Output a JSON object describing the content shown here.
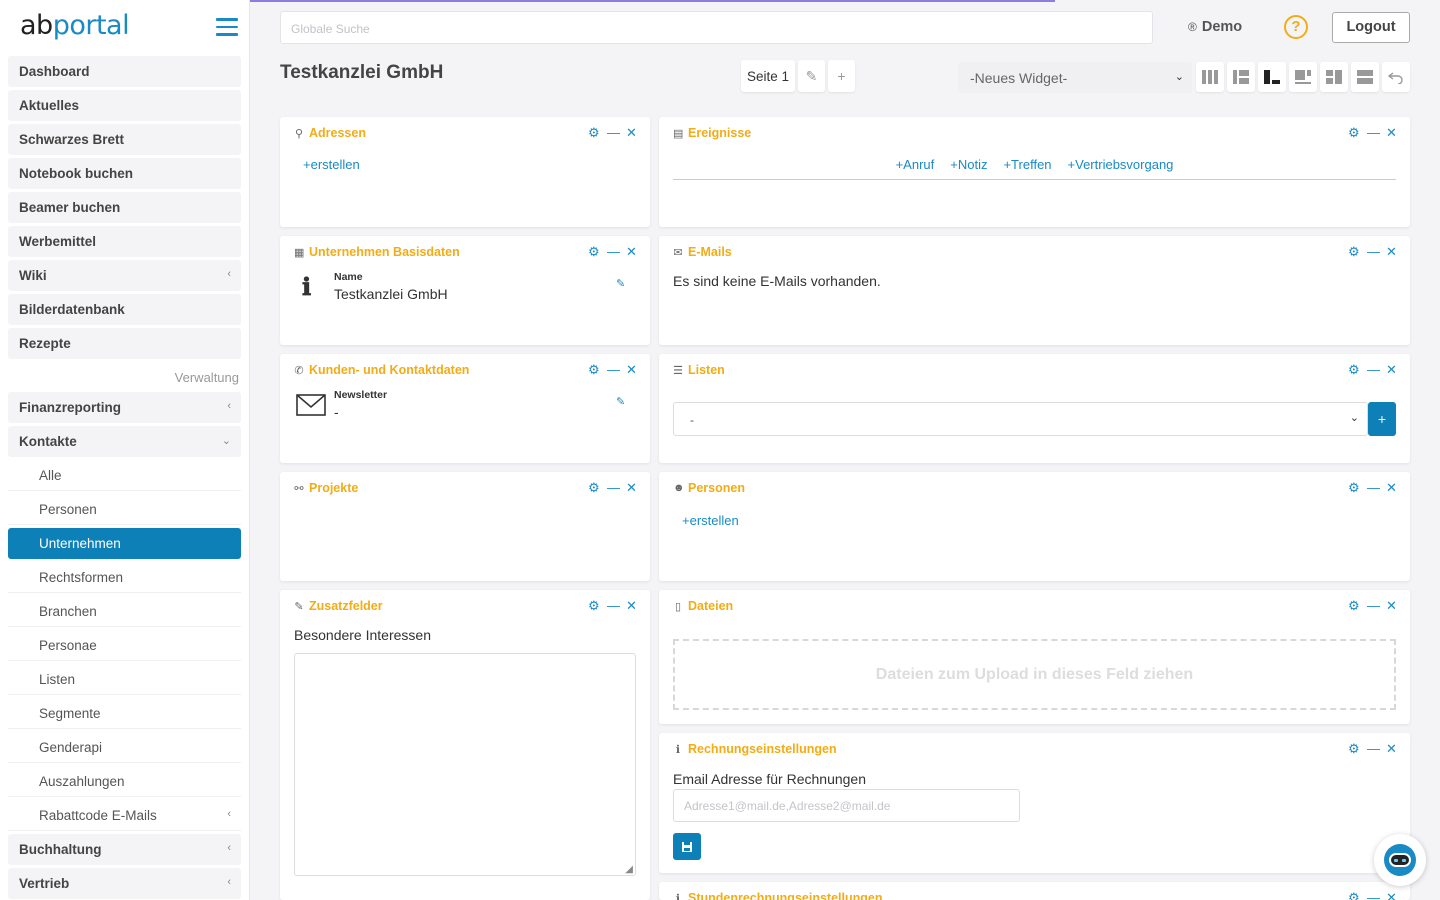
{
  "brand": {
    "logo_part1": "ab",
    "logo_part2": "portal"
  },
  "colors": {
    "accent": "#1a8ac4",
    "active": "#0e80b8",
    "widget_title": "#f2ac16",
    "progress": "#8a7fe0"
  },
  "sidebar": {
    "items": [
      {
        "label": "Dashboard"
      },
      {
        "label": "Aktuelles"
      },
      {
        "label": "Schwarzes Brett"
      },
      {
        "label": "Notebook buchen"
      },
      {
        "label": "Beamer buchen"
      },
      {
        "label": "Werbemittel"
      },
      {
        "label": "Wiki",
        "chevron": "‹"
      },
      {
        "label": "Bilderdatenbank"
      },
      {
        "label": "Rezepte"
      }
    ],
    "section_label": "Verwaltung",
    "finanz": {
      "label": "Finanzreporting",
      "chevron": "‹"
    },
    "kontakte": {
      "label": "Kontakte",
      "chevron": "⌄"
    },
    "kontakte_sub": [
      {
        "label": "Alle"
      },
      {
        "label": "Personen"
      },
      {
        "label": "Unternehmen",
        "active": true
      },
      {
        "label": "Rechtsformen"
      },
      {
        "label": "Branchen"
      },
      {
        "label": "Personae"
      },
      {
        "label": "Listen"
      },
      {
        "label": "Segmente"
      },
      {
        "label": "Genderapi"
      },
      {
        "label": "Auszahlungen"
      },
      {
        "label": "Rabattcode E-Mails",
        "chevron": "‹"
      }
    ],
    "buchhaltung": {
      "label": "Buchhaltung",
      "chevron": "‹"
    },
    "vertrieb": {
      "label": "Vertrieb",
      "chevron": "‹"
    }
  },
  "topbar": {
    "search_placeholder": "Globale Suche",
    "user_name": "Demo",
    "help_label": "?",
    "logout_label": "Logout"
  },
  "page": {
    "title": "Testkanzlei GmbH",
    "tab_label": "Seite 1",
    "widget_select": "-Neues Widget-"
  },
  "widgets": {
    "adressen": {
      "title": "Adressen",
      "create": "+erstellen"
    },
    "ereignisse": {
      "title": "Ereignisse",
      "actions": [
        "+Anruf",
        "+Notiz",
        "+Treffen",
        "+Vertriebsvorgang"
      ]
    },
    "basisdaten": {
      "title": "Unternehmen Basisdaten",
      "field_label": "Name",
      "field_value": "Testkanzlei GmbH"
    },
    "emails": {
      "title": "E-Mails",
      "empty_text": "Es sind keine E-Mails vorhanden."
    },
    "kontaktdaten": {
      "title": "Kunden- und Kontaktdaten",
      "field_label": "Newsletter",
      "field_value": "-"
    },
    "listen": {
      "title": "Listen",
      "select_value": "-",
      "add_label": "+"
    },
    "projekte": {
      "title": "Projekte"
    },
    "personen": {
      "title": "Personen",
      "create": "+erstellen"
    },
    "zusatzfelder": {
      "title": "Zusatzfelder",
      "field_label": "Besondere Interessen"
    },
    "dateien": {
      "title": "Dateien",
      "dropzone": "Dateien zum Upload in dieses Feld ziehen"
    },
    "rechnung": {
      "title": "Rechnungseinstellungen",
      "field_label": "Email Adresse für Rechnungen",
      "placeholder": "Adresse1@mail.de,Adresse2@mail.de"
    },
    "stunden": {
      "title": "Stundenrechnungseinstellungen"
    }
  }
}
